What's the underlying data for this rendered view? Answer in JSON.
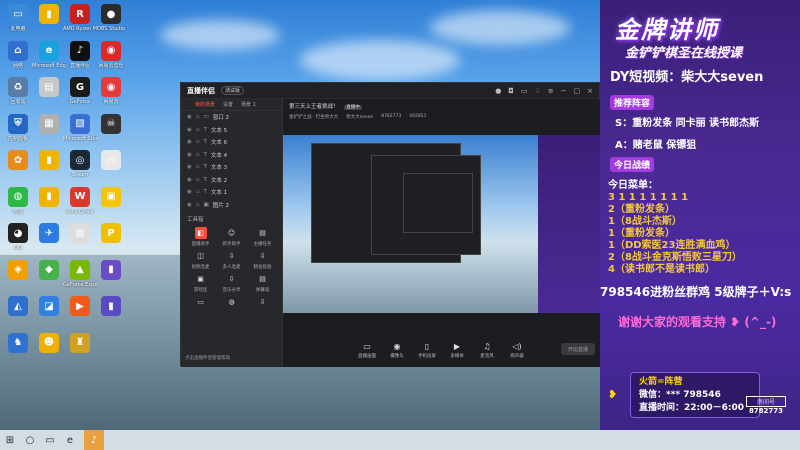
{
  "desktop": {
    "icons": [
      {
        "label": "此电脑",
        "glyph": "▭",
        "color": "#3b8ad8"
      },
      {
        "label": "",
        "glyph": "▮",
        "color": "#f0b400"
      },
      {
        "label": "AMD Ryzen Master",
        "glyph": "R",
        "color": "#c92020"
      },
      {
        "label": "OBS Studio",
        "glyph": "●",
        "color": "#2b2b2b"
      },
      {
        "label": "网络",
        "glyph": "⌂",
        "color": "#2f6fd0"
      },
      {
        "label": "Microsoft Edge",
        "glyph": "e",
        "color": "#1aa2e0"
      },
      {
        "label": "直播伴侣",
        "glyph": "♪",
        "color": "#101010"
      },
      {
        "label": "网易云音乐",
        "glyph": "◉",
        "color": "#d92a2a"
      },
      {
        "label": "回收站",
        "glyph": "♻",
        "color": "#5a7da8"
      },
      {
        "label": "",
        "glyph": "▤",
        "color": "#c8c8c8"
      },
      {
        "label": "GeForce",
        "glyph": "G",
        "color": "#1b1b1b"
      },
      {
        "label": "网易云",
        "glyph": "◉",
        "color": "#e23b3b"
      },
      {
        "label": "控制面板",
        "glyph": "⛨",
        "color": "#2468c4"
      },
      {
        "label": "",
        "glyph": "▦",
        "color": "#b0b0b0"
      },
      {
        "label": "Microsoft Store",
        "glyph": "▧",
        "color": "#3a6fd6"
      },
      {
        "label": "",
        "glyph": "☠",
        "color": "#333"
      },
      {
        "label": "",
        "glyph": "✿",
        "color": "#e88b1a"
      },
      {
        "label": "",
        "glyph": "▮",
        "color": "#f0b400"
      },
      {
        "label": "Steam",
        "glyph": "◎",
        "color": "#1b2838"
      },
      {
        "label": "",
        "glyph": "▭",
        "color": "#e8e8e8"
      },
      {
        "label": "微信",
        "glyph": "◍",
        "color": "#2fb84a"
      },
      {
        "label": "",
        "glyph": "▮",
        "color": "#f0b400"
      },
      {
        "label": "WPS Office",
        "glyph": "W",
        "color": "#d63a2f"
      },
      {
        "label": "",
        "glyph": "▣",
        "color": "#f5c600"
      },
      {
        "label": "QQ",
        "glyph": "◕",
        "color": "#222"
      },
      {
        "label": "",
        "glyph": "✈",
        "color": "#2b7be0"
      },
      {
        "label": "",
        "glyph": "▥",
        "color": "#ddd"
      },
      {
        "label": "",
        "glyph": "P",
        "color": "#f0c000"
      },
      {
        "label": "",
        "glyph": "◈",
        "color": "#f0a000"
      },
      {
        "label": "",
        "glyph": "◆",
        "color": "#46b04a"
      },
      {
        "label": "GeForce Experience",
        "glyph": "▲",
        "color": "#76b900"
      },
      {
        "label": "",
        "glyph": "▮",
        "color": "#6a4cc4"
      },
      {
        "label": "",
        "glyph": "◭",
        "color": "#2f6fd0"
      },
      {
        "label": "",
        "glyph": "◪",
        "color": "#3080e0"
      },
      {
        "label": "",
        "glyph": "▶",
        "color": "#f05a1a"
      },
      {
        "label": "",
        "glyph": "▮",
        "color": "#5a4ac4"
      },
      {
        "label": "",
        "glyph": "♞",
        "color": "#2f70d0"
      },
      {
        "label": "",
        "glyph": "☻",
        "color": "#f0b000"
      },
      {
        "label": "",
        "glyph": "♜",
        "color": "#d0a020"
      }
    ]
  },
  "taskbar": {
    "items": [
      "⊞",
      "○",
      "▭",
      "e",
      "♪"
    ]
  },
  "app": {
    "title": "直播伴侣",
    "badge": "测试版",
    "tabs": [
      "我的场景",
      "设置",
      "场景 1"
    ],
    "scenes": [
      {
        "name": "窗口 2",
        "icon": "▭"
      },
      {
        "name": "文本 5",
        "icon": "T"
      },
      {
        "name": "文本 6",
        "icon": "T"
      },
      {
        "name": "文本 4",
        "icon": "T"
      },
      {
        "name": "文本 3",
        "icon": "T"
      },
      {
        "name": "文本 2",
        "icon": "T"
      },
      {
        "name": "文本 1",
        "icon": "T"
      },
      {
        "name": "图片 2",
        "icon": "▣"
      }
    ],
    "tools_header": "工具箱",
    "tools": [
      {
        "label": "直播助手",
        "icon": "◧",
        "hot": true
      },
      {
        "label": "新手助手",
        "icon": "☺"
      },
      {
        "label": "主播任务",
        "icon": "▤"
      },
      {
        "label": "视频连麦",
        "icon": "◫"
      },
      {
        "label": "多人连麦",
        "icon": "⇩"
      },
      {
        "label": "精准投放",
        "icon": "⇩"
      },
      {
        "label": "游戏连",
        "icon": "▣"
      },
      {
        "label": "音乐分享",
        "icon": "⇩"
      },
      {
        "label": "弹幕墙",
        "icon": "▤"
      },
      {
        "label": "",
        "icon": "▭"
      },
      {
        "label": "",
        "icon": "◍"
      },
      {
        "label": "",
        "icon": "⇩"
      }
    ],
    "footer": "点击直播伴侣管理帮助",
    "info": {
      "stream_title": "第三天上王者挑战！",
      "status": "直播中",
      "nick": "金铲铲之战 · 打坐师大大",
      "host": "柴大大seven",
      "room": "8782773",
      "count": "492851"
    },
    "controls": [
      {
        "label": "直播画面",
        "icon": "▭"
      },
      {
        "label": "摄像头",
        "icon": "◉"
      },
      {
        "label": "手机投屏",
        "icon": "▯"
      },
      {
        "label": "多媒体",
        "icon": "▶"
      },
      {
        "label": "麦克风",
        "icon": "♫"
      },
      {
        "label": "扬声器",
        "icon": "◁)"
      }
    ],
    "start_label": "开始直播"
  },
  "panel": {
    "title": "金牌讲师",
    "subtitle": "金铲铲棋圣在线授课",
    "dy": "DY短视频：柴大大seven",
    "tag1": "推荐阵容",
    "s_line": "S：重粉发条 同卡丽 读书郎杰斯",
    "a_line": "A：赌老鼠 保镖狙",
    "tag2": "今日战绩",
    "menu_head": "今日菜单：",
    "menu_lines": [
      "3 1 1 1 1 1 1 1",
      "2（重粉发条）",
      "1（8战斗杰斯）",
      "1（重粉发条）",
      "1（DD索医23连胜满血鸡）",
      "2（8战斗金克斯悟败三星刀）",
      "4（读书郎不是读书郎）"
    ],
    "ticker": "798546进粉丝群鸡 5级牌子＋V:s",
    "thanks": "谢谢大家的观看支持 ❥ (^_-)",
    "fans_label": "火箭=阵营",
    "wechat": "微信：*** 798546",
    "time": "直播时间：22:00－6:00",
    "room_label": "房间号",
    "room_number": "8782773",
    "accent": "#a33be0"
  }
}
